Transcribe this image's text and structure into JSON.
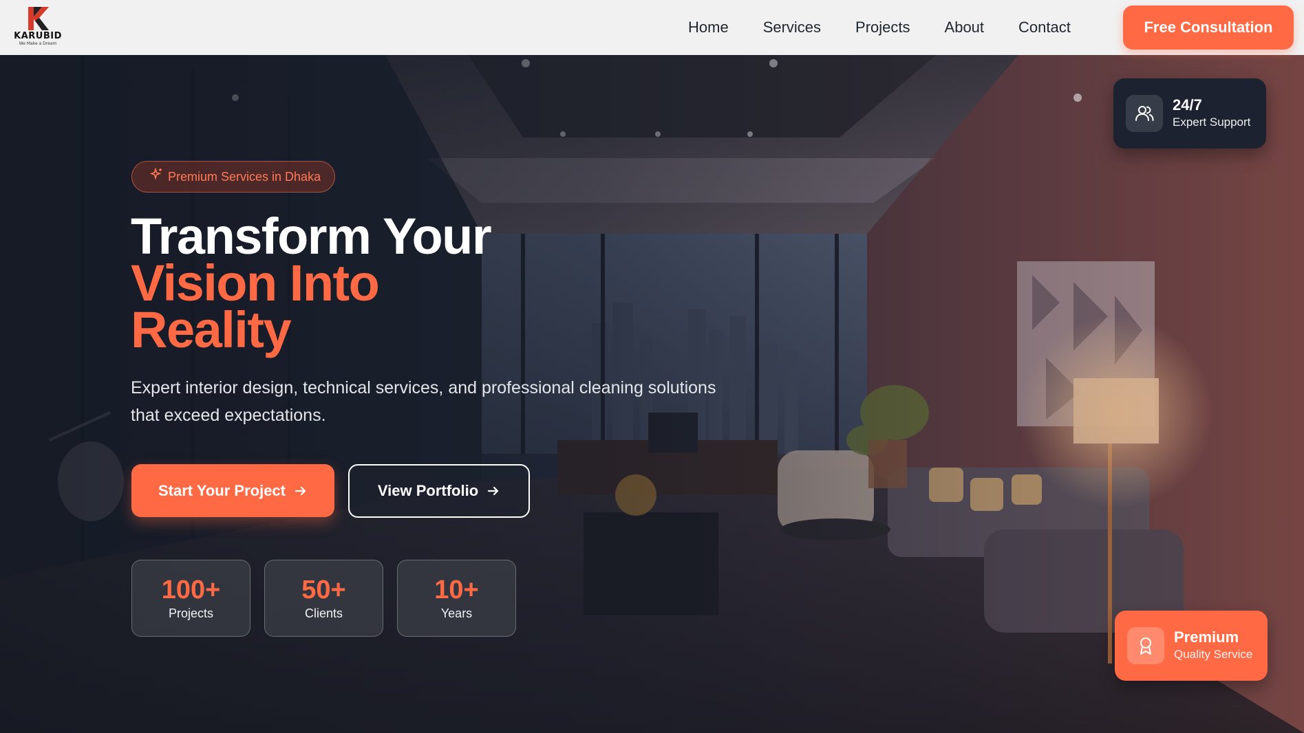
{
  "brand": {
    "name": "KARUBID",
    "tagline": "We Make a Dream"
  },
  "nav": {
    "links": [
      "Home",
      "Services",
      "Projects",
      "About",
      "Contact"
    ],
    "cta_label": "Free Consultation"
  },
  "hero": {
    "badge": "Premium Services in Dhaka",
    "title_line1": "Transform Your",
    "title_line2": "Vision Into",
    "title_line3": "Reality",
    "description": "Expert interior design, technical services, and professional cleaning solutions that exceed expectations.",
    "primary_button": "Start Your Project",
    "secondary_button": "View Portfolio",
    "stats": [
      {
        "value": "100+",
        "label": "Projects"
      },
      {
        "value": "50+",
        "label": "Clients"
      },
      {
        "value": "10+",
        "label": "Years"
      }
    ]
  },
  "support_card": {
    "title": "24/7",
    "subtitle": "Expert Support"
  },
  "premium_card": {
    "title": "Premium",
    "subtitle": "Quality Service"
  },
  "colors": {
    "accent": "#ff6a45",
    "navbar": "#f1f1f1",
    "dark_card": "#1c2230"
  }
}
